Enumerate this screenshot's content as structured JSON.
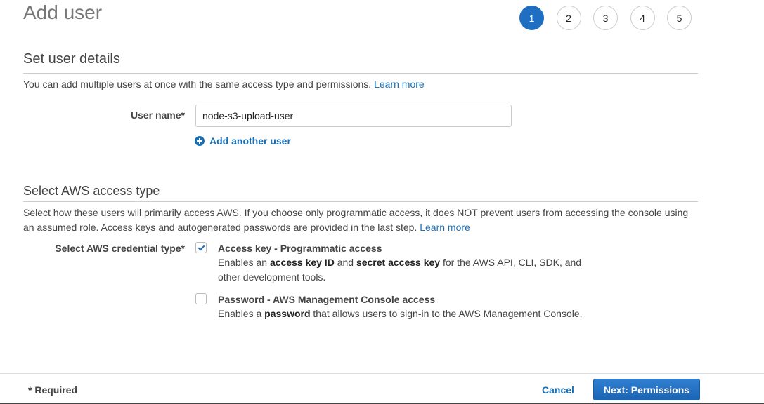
{
  "header": {
    "title": "Add user",
    "steps": [
      "1",
      "2",
      "3",
      "4",
      "5"
    ]
  },
  "details": {
    "title": "Set user details",
    "description": "You can add multiple users at once with the same access type and permissions.",
    "learn_more": "Learn more",
    "username_label": "User name*",
    "username_value": "node-s3-upload-user",
    "add_another": "Add another user"
  },
  "access": {
    "title": "Select AWS access type",
    "description": "Select how these users will primarily access AWS. If you choose only programmatic access, it does NOT prevent users from accessing the console using an assumed role. Access keys and autogenerated passwords are provided in the last step.",
    "learn_more": "Learn more",
    "credential_label": "Select AWS credential type*",
    "options": [
      {
        "title": "Access key - Programmatic access",
        "checked": true,
        "desc_1": "Enables an ",
        "desc_b1": "access key ID",
        "desc_2": " and ",
        "desc_b2": "secret access key",
        "desc_3": " for the AWS API, CLI, SDK, and other development tools."
      },
      {
        "title": "Password - AWS Management Console access",
        "checked": false,
        "desc_1": "Enables a ",
        "desc_b1": "password",
        "desc_2": " that allows users to sign-in to the AWS Management Console."
      }
    ]
  },
  "footer": {
    "required": "* Required",
    "cancel": "Cancel",
    "next": "Next: Permissions"
  },
  "colors": {
    "primary": "#1f6ec1",
    "link": "#1a6fb5"
  }
}
